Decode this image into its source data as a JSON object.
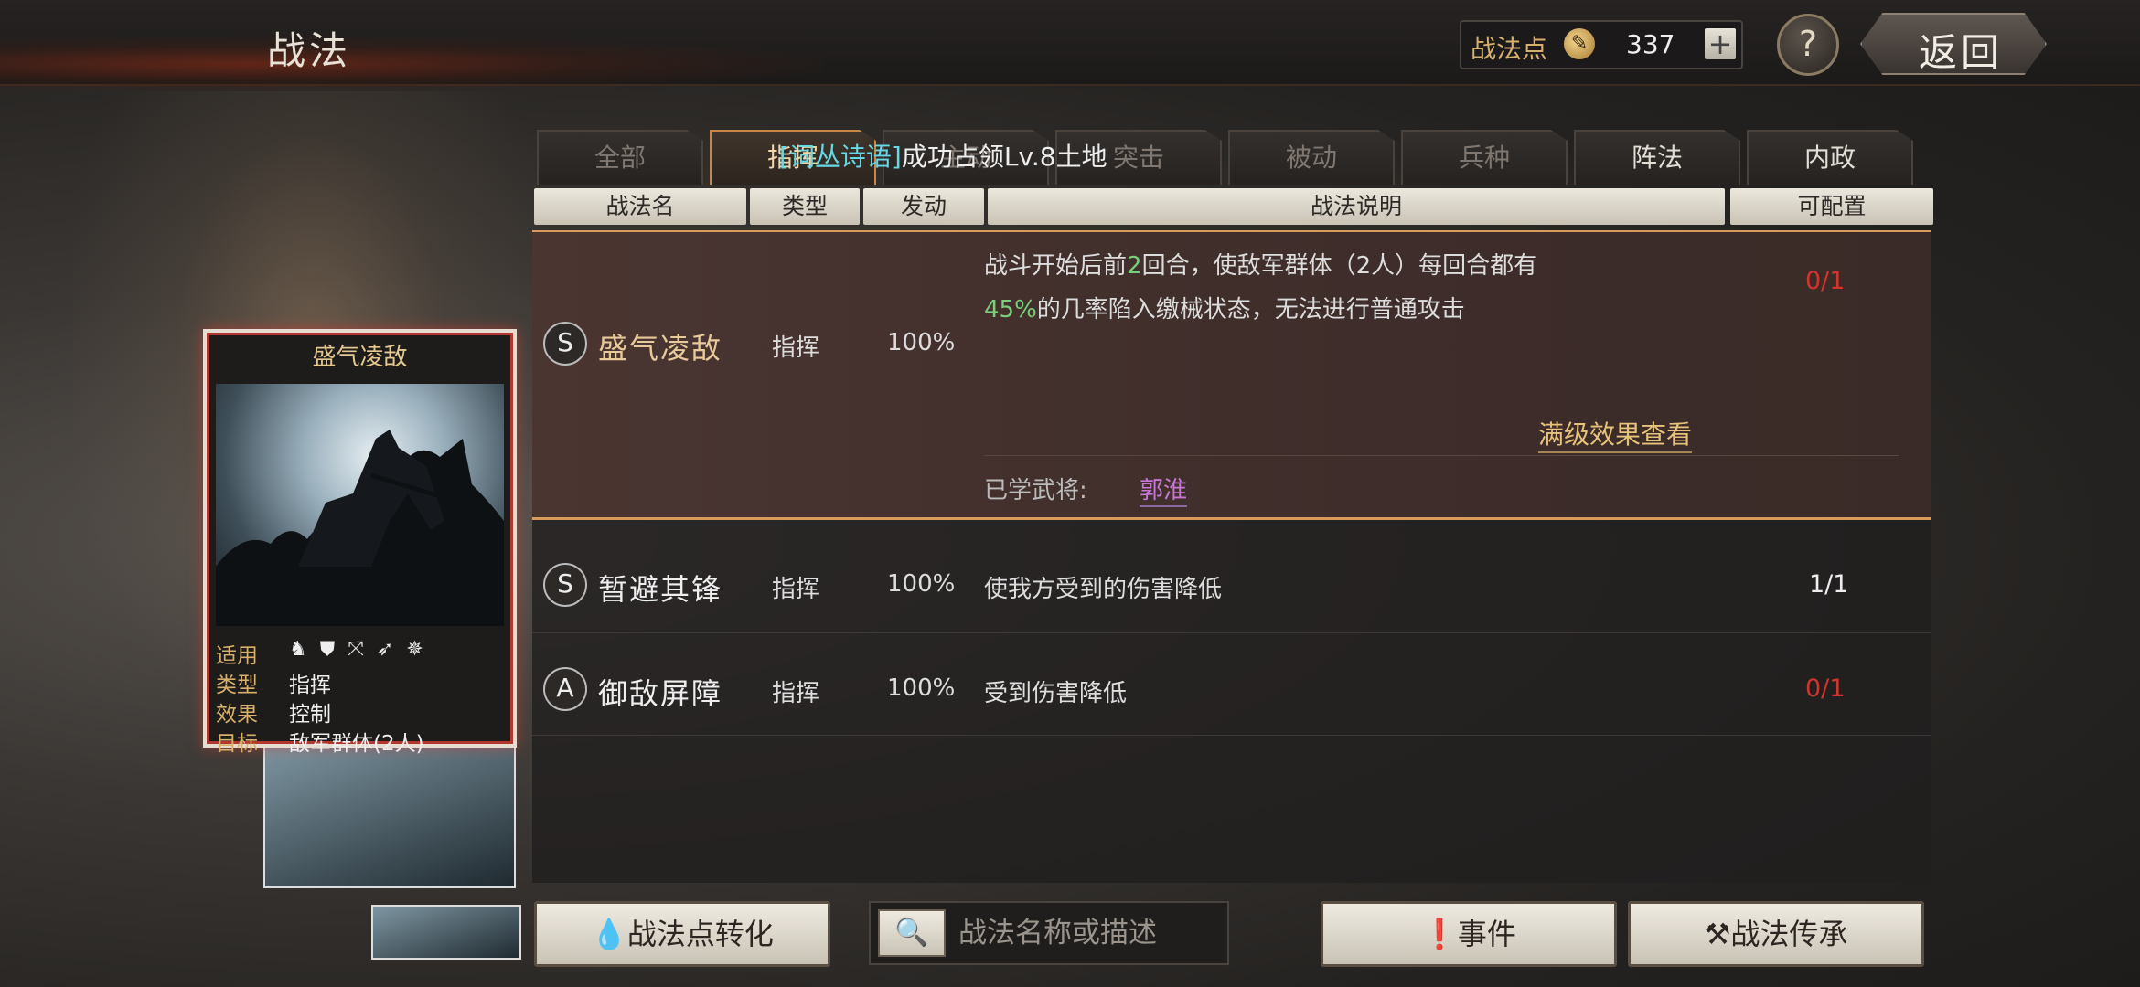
{
  "header": {
    "title": "战法",
    "points_label": "战法点",
    "points_value": "337",
    "plus_label": "+",
    "help_label": "?",
    "back_label": "返回"
  },
  "tabs": [
    {
      "label": "全部",
      "state": "disabled"
    },
    {
      "label": "指挥",
      "state": "active"
    },
    {
      "label": "主动",
      "state": "disabled"
    },
    {
      "label": "突击",
      "state": "disabled"
    },
    {
      "label": "被动",
      "state": "disabled"
    },
    {
      "label": "兵种",
      "state": "disabled"
    },
    {
      "label": "阵法",
      "state": "enabled"
    },
    {
      "label": "内政",
      "state": "enabled"
    }
  ],
  "tooltip": {
    "tag": "[词丛诗语]",
    "text": "成功占领Lv.8土地"
  },
  "columns": [
    "战法名",
    "类型",
    "发动",
    "战法说明",
    "可配置"
  ],
  "card": {
    "title": "盛气凌敌",
    "rows": [
      {
        "key": "适用",
        "value": ""
      },
      {
        "key": "类型",
        "value": "指挥"
      },
      {
        "key": "效果",
        "value": "控制"
      },
      {
        "key": "目标",
        "value": "敌军群体(2人)"
      }
    ],
    "unit_icons": [
      "cavalry-icon",
      "shield-icon",
      "bow-icon",
      "spear-icon",
      "wheel-icon"
    ]
  },
  "tactics": [
    {
      "grade": "S",
      "name": "盛气凌敌",
      "type": "指挥",
      "rate": "100%",
      "desc_line1_pre": "战斗开始后前",
      "desc_line1_num": "2",
      "desc_line1_post": "回合，使敌军群体（2人）每回合都有",
      "desc_line2_num": "45%",
      "desc_line2_post": "的几率陷入缴械状态，无法进行普通攻击",
      "config": "0/1",
      "max_effect_link": "满级效果查看",
      "learned_label": "已学武将:",
      "learned_name": "郭淮"
    },
    {
      "grade": "S",
      "name": "暂避其锋",
      "type": "指挥",
      "rate": "100%",
      "desc": "使我方受到的伤害降低",
      "config": "1/1"
    },
    {
      "grade": "A",
      "name": "御敌屏障",
      "type": "指挥",
      "rate": "100%",
      "desc": "受到伤害降低",
      "config": "0/1"
    }
  ],
  "bottom": {
    "convert_label": "战法点转化",
    "search_placeholder": "战法名称或描述",
    "event_label": "事件",
    "inherit_label": "战法传承"
  },
  "colors": {
    "accent_gold": "#e7c27a",
    "config_red": "#d3342d",
    "highlight_green": "#79cf7b",
    "tag_cyan": "#67d8e6"
  }
}
